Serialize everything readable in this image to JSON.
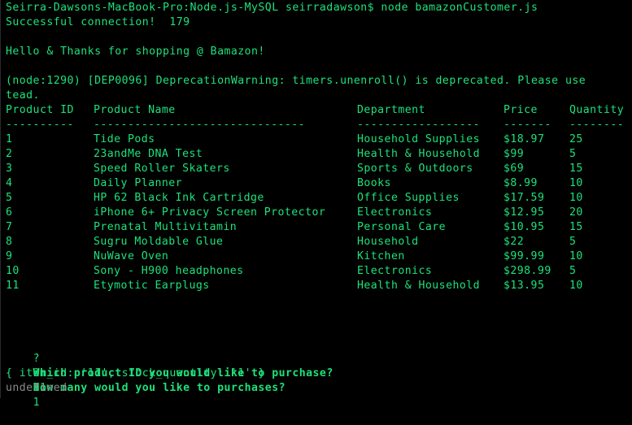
{
  "terminal": {
    "prompt_line": "Seirra-Dawsons-MacBook-Pro:Node.js-MySQL seirradawson$ node bamazonCustomer.js",
    "connection_line": "Successful connection!  179",
    "greeting_line": "Hello & Thanks for shopping @ Bamazon!",
    "warning_line_1": "(node:1290) [DEP0096] DeprecationWarning: timers.unenroll() is deprecated. Please use",
    "warning_line_2": "tead."
  },
  "table": {
    "headers": {
      "id": "Product ID",
      "name": "Product Name",
      "dept": "Department",
      "price": "Price",
      "qty": "Quantity"
    },
    "separators": {
      "id": "----------",
      "name": "-------------------------------",
      "dept": "------------------",
      "price": "-------",
      "qty": "--------"
    },
    "rows": [
      {
        "id": "1",
        "name": "Tide Pods",
        "dept": "Household Supplies",
        "price": "$18.97",
        "qty": "25"
      },
      {
        "id": "2",
        "name": "23andMe DNA Test",
        "dept": "Health & Household",
        "price": "$99",
        "qty": "5"
      },
      {
        "id": "3",
        "name": "Speed Roller Skaters",
        "dept": "Sports & Outdoors",
        "price": "$69",
        "qty": "15"
      },
      {
        "id": "4",
        "name": "Daily Planner",
        "dept": "Books",
        "price": "$8.99",
        "qty": "10"
      },
      {
        "id": "5",
        "name": "HP 62 Black Ink Cartridge",
        "dept": "Office Supplies",
        "price": "$17.59",
        "qty": "10"
      },
      {
        "id": "6",
        "name": "iPhone 6+ Privacy Screen Protector",
        "dept": "Electronics",
        "price": "$12.95",
        "qty": "20"
      },
      {
        "id": "7",
        "name": "Prenatal Multivitamin",
        "dept": "Personal Care",
        "price": "$10.95",
        "qty": "15"
      },
      {
        "id": "8",
        "name": "Sugru Moldable Glue",
        "dept": "Household",
        "price": "$22",
        "qty": "5"
      },
      {
        "id": "9",
        "name": "NuWave Oven",
        "dept": "Kitchen",
        "price": "$99.99",
        "qty": "10"
      },
      {
        "id": "10",
        "name": "Sony - H900 headphones",
        "dept": "Electronics",
        "price": "$298.99",
        "qty": "5"
      },
      {
        "id": "11",
        "name": "Etymotic Earplugs",
        "dept": "Health & Household",
        "price": "$13.95",
        "qty": "10"
      }
    ]
  },
  "prompts": {
    "q1_mark": "?",
    "q1_text": "Which product ID you would like to purchase?",
    "q1_answer": "11",
    "q2_mark": "?",
    "q2_text": "How many would you like to purchases?",
    "q2_answer": "1",
    "object_line": "{ item_id: '11', stock_quantity: '1' }",
    "undefined_line": "undefined"
  },
  "colors": {
    "background": "#000000",
    "foreground": "#1de27a",
    "dim": "#8a8a8a"
  }
}
